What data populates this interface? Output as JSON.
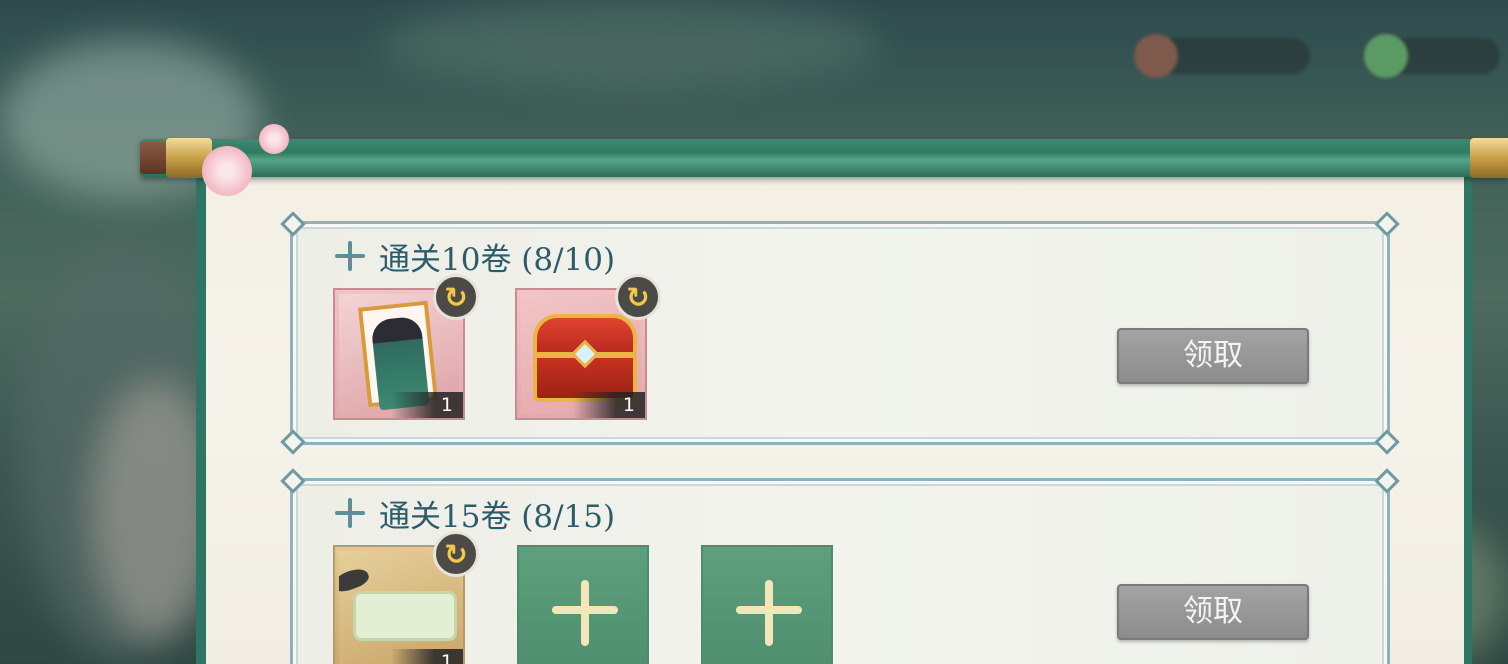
{
  "screen": {
    "tasks": [
      {
        "title": "通关10卷 (8/10)",
        "claim_label": "领取",
        "rewards": [
          {
            "item": "character-card",
            "count": "1",
            "swap_icon": "swap-icon"
          },
          {
            "item": "treasure-chest",
            "count": "1",
            "swap_icon": "swap-icon"
          }
        ]
      },
      {
        "title": "通关15卷 (8/15)",
        "claim_label": "领取",
        "rewards": [
          {
            "item": "bamboo-letter",
            "count": "1",
            "swap_icon": "swap-icon"
          },
          {
            "item": "empty-slot"
          },
          {
            "item": "empty-slot"
          }
        ]
      }
    ]
  },
  "colors": {
    "panel_green": "#2f7a61",
    "card_border": "#8eb2b8",
    "title_text": "#2e5b6a",
    "claim_button_disabled": "#969696",
    "empty_slot_green": "#5e9f7d"
  }
}
